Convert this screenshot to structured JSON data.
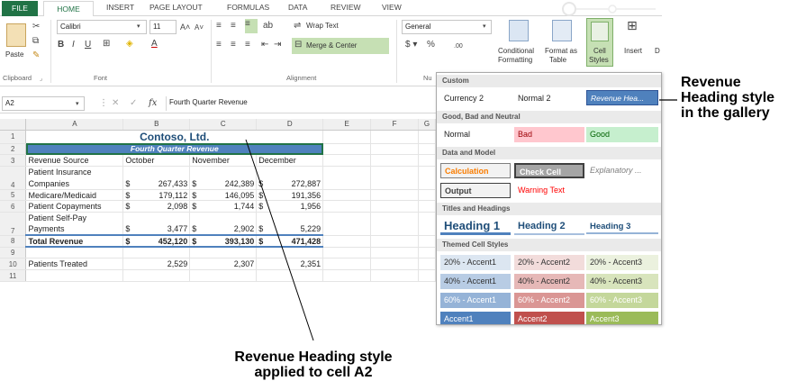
{
  "tabs": [
    "FILE",
    "HOME",
    "INSERT",
    "PAGE LAYOUT",
    "FORMULAS",
    "DATA",
    "REVIEW",
    "VIEW"
  ],
  "ribbon": {
    "clipboard": {
      "paste": "Paste",
      "label": "Clipboard"
    },
    "font": {
      "name": "Calibri",
      "size": "11",
      "label": "Font"
    },
    "alignment": {
      "wrap": "Wrap Text",
      "merge": "Merge & Center",
      "label": "Alignment"
    },
    "number": {
      "format": "General",
      "label": "Nu"
    },
    "styles": {
      "conditional_1": "Conditional",
      "conditional_2": "Formatting",
      "format_as_1": "Format as",
      "format_as_2": "Table",
      "cell_styles_1": "Cell",
      "cell_styles_2": "Styles",
      "insert": "Insert",
      "d": "D"
    }
  },
  "formula_bar": {
    "name_box": "A2",
    "fx": "fx",
    "content": "Fourth Quarter Revenue"
  },
  "sheet": {
    "columns": [
      "A",
      "B",
      "C",
      "D",
      "E",
      "F",
      "G"
    ],
    "title": "Contoso, Ltd.",
    "heading": "Fourth Quarter Revenue",
    "headers": [
      "Revenue Source",
      "October",
      "November",
      "December"
    ],
    "rows": [
      {
        "n": "4",
        "label_1": "Patient Insurance",
        "label_2": "Companies",
        "oct": "267,433",
        "nov": "242,389",
        "dec": "272,887"
      },
      {
        "n": "5",
        "label": "Medicare/Medicaid",
        "oct": "179,112",
        "nov": "146,095",
        "dec": "191,356"
      },
      {
        "n": "6",
        "label": "Patient Copayments",
        "oct": "2,098",
        "nov": "1,744",
        "dec": "1,956"
      },
      {
        "n": "7",
        "label_1": "Patient Self-Pay",
        "label_2": "Payments",
        "oct": "3,477",
        "nov": "2,902",
        "dec": "5,229"
      },
      {
        "n": "8",
        "label": "Total Revenue",
        "oct": "452,120",
        "nov": "393,130",
        "dec": "471,428"
      },
      {
        "n": "10",
        "label": "Patients Treated",
        "oct": "2,529",
        "nov": "2,307",
        "dec": "2,351"
      }
    ],
    "row_numbers": [
      "1",
      "2",
      "3",
      "9",
      "11"
    ],
    "currency": "$"
  },
  "gallery": {
    "sections": {
      "custom": "Custom",
      "good_bad": "Good, Bad and Neutral",
      "data_model": "Data and Model",
      "titles": "Titles and Headings",
      "themed": "Themed Cell Styles"
    },
    "custom": [
      "Currency 2",
      "Normal 2",
      "Revenue Hea..."
    ],
    "good_bad": [
      "Normal",
      "Bad",
      "Good"
    ],
    "data_model_1": [
      "Calculation",
      "Check Cell",
      "Explanatory ..."
    ],
    "data_model_2": [
      "Output",
      "Warning Text"
    ],
    "titles": [
      "Heading 1",
      "Heading 2",
      "Heading 3"
    ],
    "accent20": [
      "20% - Accent1",
      "20% - Accent2",
      "20% - Accent3"
    ],
    "accent40": [
      "40% - Accent1",
      "40% - Accent2",
      "40% - Accent3"
    ],
    "accent60": [
      "60% - Accent1",
      "60% - Accent2",
      "60% - Accent3"
    ],
    "accent": [
      "Accent1",
      "Accent2",
      "Accent3"
    ]
  },
  "callouts": {
    "gallery_1": "Revenue",
    "gallery_2": "Heading style",
    "gallery_3": "in the gallery",
    "cell_1": "Revenue Heading style",
    "cell_2": "applied to cell A2"
  },
  "colors": {
    "excel_green": "#217346",
    "heading_blue": "#4f81bd"
  }
}
